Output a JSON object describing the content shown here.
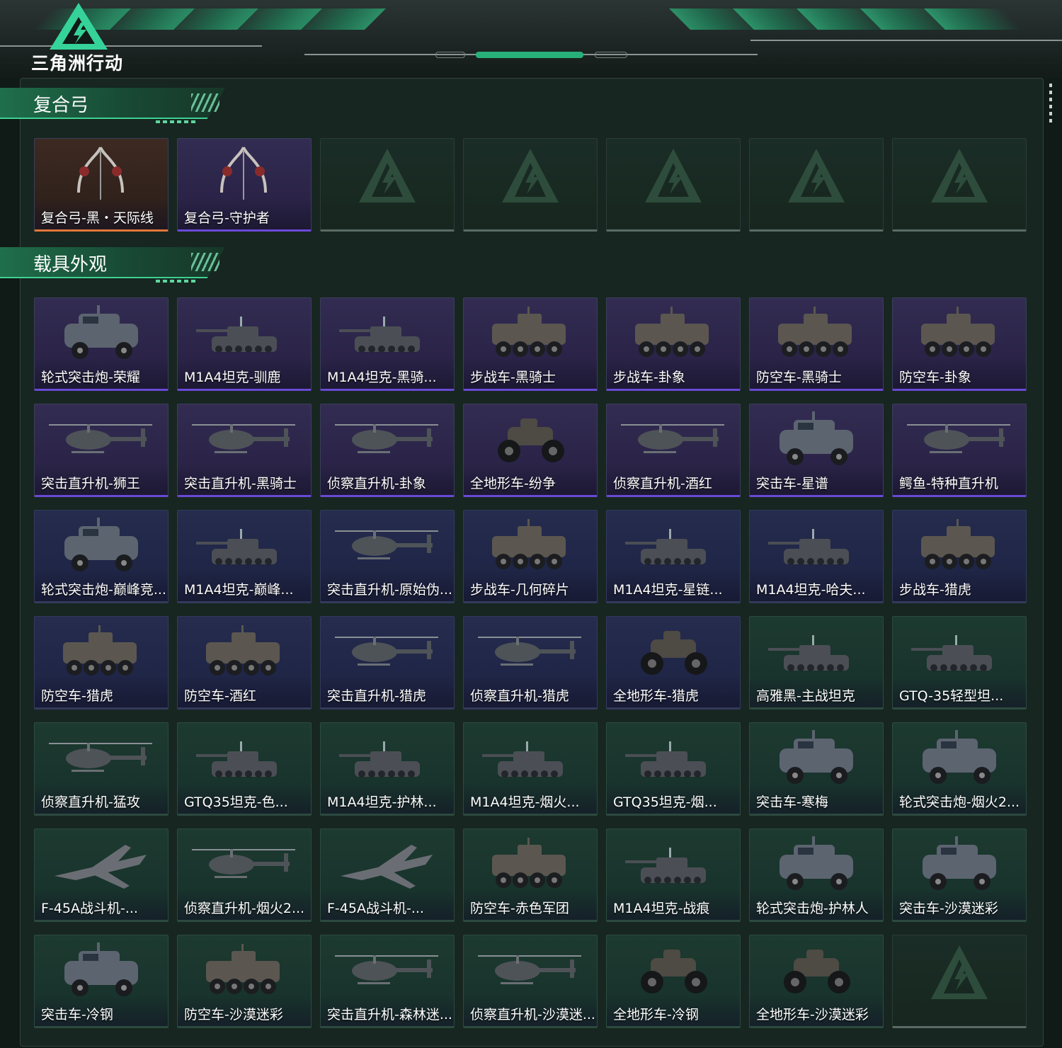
{
  "header": {
    "brand": "三角洲行动"
  },
  "sections": [
    {
      "title": "复合弓",
      "items": [
        {
          "name": "复合弓-黑・天际线",
          "rarity": "orange",
          "icon": "bow-icon"
        },
        {
          "name": "复合弓-守护者",
          "rarity": "purple",
          "icon": "bow-icon"
        },
        {
          "name": "",
          "rarity": "empty"
        },
        {
          "name": "",
          "rarity": "empty"
        },
        {
          "name": "",
          "rarity": "empty"
        },
        {
          "name": "",
          "rarity": "empty"
        },
        {
          "name": "",
          "rarity": "empty"
        }
      ]
    },
    {
      "title": "载具外观",
      "items": [
        {
          "name": "轮式突击炮-荣耀",
          "rarity": "purple",
          "icon": "armored-car-icon"
        },
        {
          "name": "M1A4坦克-驯鹿",
          "rarity": "purple",
          "icon": "tank-icon"
        },
        {
          "name": "M1A4坦克-黑骑...",
          "rarity": "purple",
          "icon": "tank-icon"
        },
        {
          "name": "步战车-黑骑士",
          "rarity": "purple",
          "icon": "ifv-icon"
        },
        {
          "name": "步战车-卦象",
          "rarity": "purple",
          "icon": "ifv-icon"
        },
        {
          "name": "防空车-黑骑士",
          "rarity": "purple",
          "icon": "ifv-icon"
        },
        {
          "name": "防空车-卦象",
          "rarity": "purple",
          "icon": "ifv-icon"
        },
        {
          "name": "突击直升机-狮王",
          "rarity": "purple",
          "icon": "helicopter-icon"
        },
        {
          "name": "突击直升机-黑骑士",
          "rarity": "purple",
          "icon": "helicopter-icon"
        },
        {
          "name": "侦察直升机-卦象",
          "rarity": "purple",
          "icon": "helicopter-icon"
        },
        {
          "name": "全地形车-纷争",
          "rarity": "purple",
          "icon": "atv-icon"
        },
        {
          "name": "侦察直升机-酒红",
          "rarity": "purple",
          "icon": "helicopter-icon"
        },
        {
          "name": "突击车-星谱",
          "rarity": "purple",
          "icon": "armored-car-icon"
        },
        {
          "name": "鳄鱼-特种直升机",
          "rarity": "purple",
          "icon": "helicopter-icon"
        },
        {
          "name": "轮式突击炮-巅峰竞...",
          "rarity": "blue",
          "icon": "armored-car-icon"
        },
        {
          "name": "M1A4坦克-巅峰...",
          "rarity": "blue",
          "icon": "tank-icon"
        },
        {
          "name": "突击直升机-原始伪...",
          "rarity": "blue",
          "icon": "helicopter-icon"
        },
        {
          "name": "步战车-几何碎片",
          "rarity": "blue",
          "icon": "ifv-icon"
        },
        {
          "name": "M1A4坦克-星链...",
          "rarity": "blue",
          "icon": "tank-icon"
        },
        {
          "name": "M1A4坦克-哈夫...",
          "rarity": "blue",
          "icon": "tank-icon"
        },
        {
          "name": "步战车-猎虎",
          "rarity": "blue",
          "icon": "ifv-icon"
        },
        {
          "name": "防空车-猎虎",
          "rarity": "blue",
          "icon": "ifv-icon"
        },
        {
          "name": "防空车-酒红",
          "rarity": "blue",
          "icon": "ifv-icon"
        },
        {
          "name": "突击直升机-猎虎",
          "rarity": "blue",
          "icon": "helicopter-icon"
        },
        {
          "name": "侦察直升机-猎虎",
          "rarity": "blue",
          "icon": "helicopter-icon"
        },
        {
          "name": "全地形车-猎虎",
          "rarity": "blue",
          "icon": "atv-icon"
        },
        {
          "name": "高雅黑-主战坦克",
          "rarity": "green",
          "icon": "tank-icon"
        },
        {
          "name": "GTQ-35轻型坦...",
          "rarity": "green",
          "icon": "tank-icon"
        },
        {
          "name": "侦察直升机-猛攻",
          "rarity": "green",
          "icon": "helicopter-icon"
        },
        {
          "name": "GTQ35坦克-色...",
          "rarity": "green",
          "icon": "tank-icon"
        },
        {
          "name": "M1A4坦克-护林...",
          "rarity": "green",
          "icon": "tank-icon"
        },
        {
          "name": "M1A4坦克-烟火...",
          "rarity": "green",
          "icon": "tank-icon"
        },
        {
          "name": "GTQ35坦克-烟...",
          "rarity": "green",
          "icon": "tank-icon"
        },
        {
          "name": "突击车-寒梅",
          "rarity": "green",
          "icon": "armored-car-icon"
        },
        {
          "name": "轮式突击炮-烟火2...",
          "rarity": "green",
          "icon": "armored-car-icon"
        },
        {
          "name": "F-45A战斗机-...",
          "rarity": "green",
          "icon": "jet-icon"
        },
        {
          "name": "侦察直升机-烟火2...",
          "rarity": "green",
          "icon": "helicopter-icon"
        },
        {
          "name": "F-45A战斗机-...",
          "rarity": "green",
          "icon": "jet-icon"
        },
        {
          "name": "防空车-赤色军团",
          "rarity": "green",
          "icon": "ifv-icon"
        },
        {
          "name": "M1A4坦克-战痕",
          "rarity": "green",
          "icon": "tank-icon"
        },
        {
          "name": "轮式突击炮-护林人",
          "rarity": "green",
          "icon": "armored-car-icon"
        },
        {
          "name": "突击车-沙漠迷彩",
          "rarity": "green",
          "icon": "armored-car-icon"
        },
        {
          "name": "突击车-冷钢",
          "rarity": "green",
          "icon": "armored-car-icon"
        },
        {
          "name": "防空车-沙漠迷彩",
          "rarity": "green",
          "icon": "ifv-icon"
        },
        {
          "name": "突击直升机-森林迷...",
          "rarity": "green",
          "icon": "helicopter-icon"
        },
        {
          "name": "侦察直升机-沙漠迷...",
          "rarity": "green",
          "icon": "helicopter-icon"
        },
        {
          "name": "全地形车-冷钢",
          "rarity": "green",
          "icon": "atv-icon"
        },
        {
          "name": "全地形车-沙漠迷彩",
          "rarity": "green",
          "icon": "atv-icon"
        },
        {
          "name": "",
          "rarity": "empty"
        }
      ]
    }
  ],
  "colors": {
    "orange": "#e0773a",
    "purple": "#6a49d6",
    "blue": "#3a66d8",
    "green": "#38c889",
    "accent": "#2fae79"
  }
}
